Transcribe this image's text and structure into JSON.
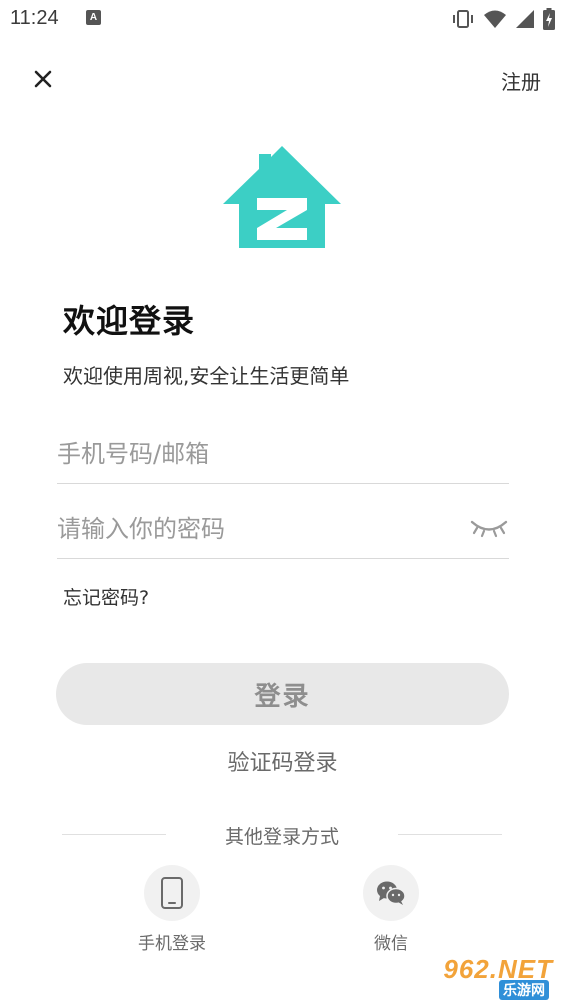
{
  "status_bar": {
    "time": "11:24",
    "notification_badge": "A",
    "icons": [
      "vibrate-icon",
      "wifi-icon",
      "signal-icon",
      "battery-icon"
    ]
  },
  "header": {
    "close_icon": "close-icon",
    "register_label": "注册"
  },
  "logo": {
    "letter": "Z",
    "color": "#3ccfc5"
  },
  "welcome": {
    "title": "欢迎登录",
    "subtitle": "欢迎使用周视,安全让生活更简单"
  },
  "form": {
    "phone_placeholder": "手机号码/邮箱",
    "password_placeholder": "请输入你的密码",
    "eye_icon": "eye-closed-icon",
    "forgot_label": "忘记密码?"
  },
  "login_button": {
    "label": "登录"
  },
  "sms_login": {
    "label": "验证码登录"
  },
  "other_methods": {
    "title": "其他登录方式",
    "items": [
      {
        "label": "手机登录",
        "icon": "phone-icon"
      },
      {
        "label": "微信",
        "icon": "wechat-icon"
      }
    ]
  },
  "watermark": {
    "top": "962.NET",
    "bottom": "乐游网"
  },
  "colors": {
    "accent": "#3ccfc5",
    "button_bg": "#e8e8e8",
    "button_text": "#8e8e8e"
  }
}
